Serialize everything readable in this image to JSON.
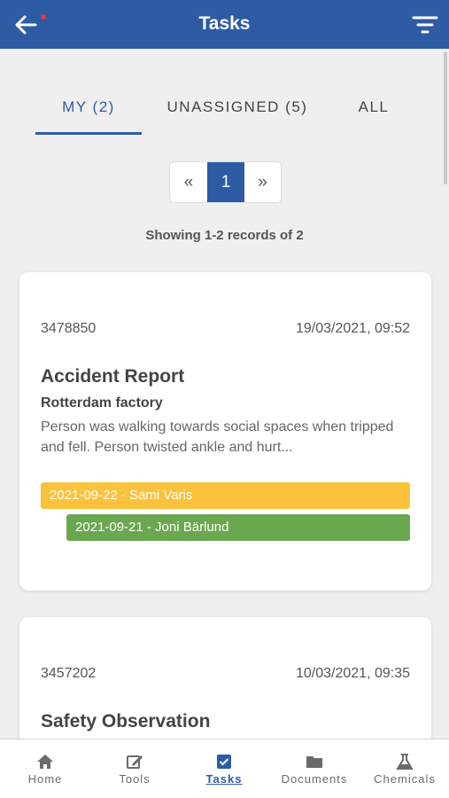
{
  "header": {
    "title": "Tasks",
    "back_icon": "back-arrow-icon",
    "filter_icon": "filter-icon",
    "notification_color": "#e53935"
  },
  "tabs": [
    {
      "label": "MY (2)"
    },
    {
      "label": "UNASSIGNED (5)"
    },
    {
      "label": "ALL"
    }
  ],
  "pagination": {
    "prev": "«",
    "current": "1",
    "next": "»"
  },
  "records_info": "Showing 1-2 records of 2",
  "tasks": [
    {
      "id": "3478850",
      "datetime": "19/03/2021, 09:52",
      "title": "Accident Report",
      "location": "Rotterdam factory",
      "description": "Person was walking towards social spaces when tripped and fell. Person twisted ankle and hurt...",
      "assignments": [
        {
          "label": "2021-09-22 - Sami Varis",
          "color": "#fbc23d"
        },
        {
          "label": "2021-09-21 - Joni Bärlund",
          "color": "#6aa84f"
        }
      ]
    },
    {
      "id": "3457202",
      "datetime": "10/03/2021, 09:35",
      "title": "Safety Observation"
    }
  ],
  "bottom_nav": [
    {
      "label": "Home",
      "icon": "home-icon"
    },
    {
      "label": "Tools",
      "icon": "edit-icon"
    },
    {
      "label": "Tasks",
      "icon": "checkbox-icon"
    },
    {
      "label": "Documents",
      "icon": "folder-icon"
    },
    {
      "label": "Chemicals",
      "icon": "flask-icon"
    }
  ],
  "colors": {
    "primary": "#2d5ca4",
    "background": "#efefef"
  }
}
